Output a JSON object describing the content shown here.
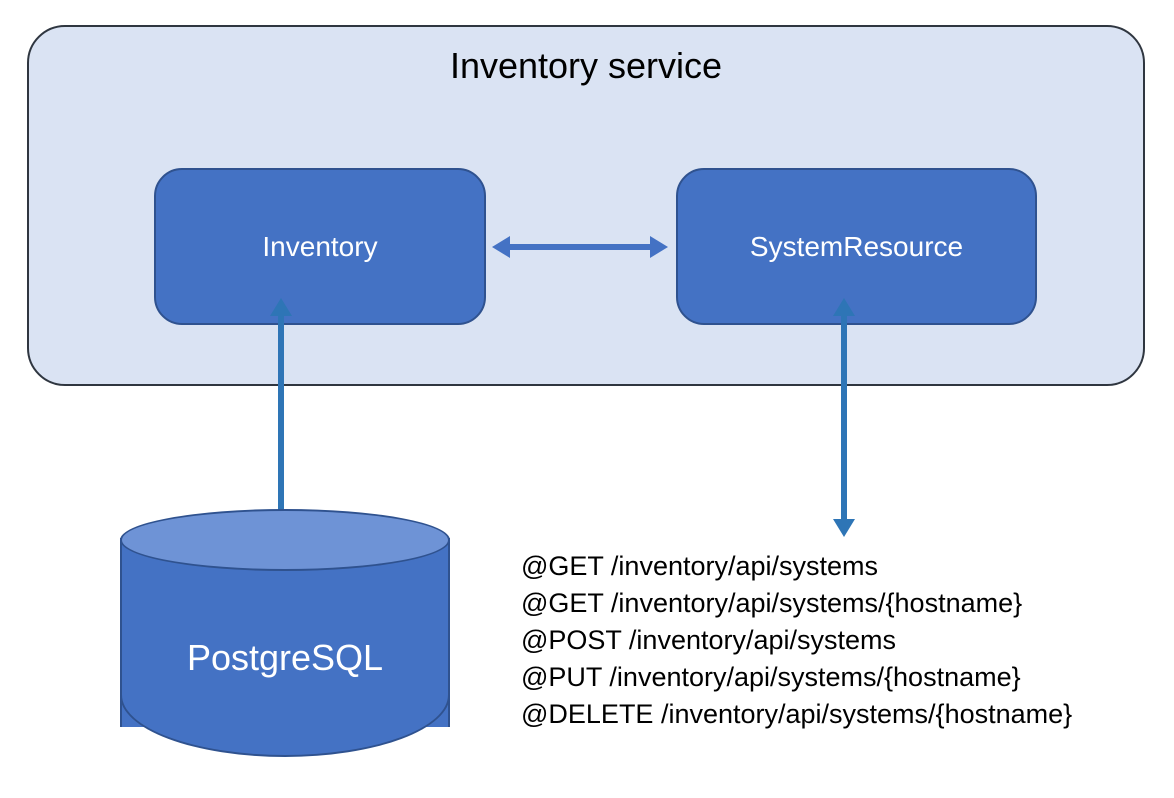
{
  "service": {
    "title": "Inventory service",
    "boxes": {
      "inventory": "Inventory",
      "systemresource": "SystemResource"
    }
  },
  "database": {
    "label": "PostgreSQL"
  },
  "api": {
    "endpoints": [
      "@GET /inventory/api/systems",
      "@GET /inventory/api/systems/{hostname}",
      "@POST /inventory/api/systems",
      "@PUT /inventory/api/systems/{hostname}",
      "@DELETE /inventory/api/systems/{hostname}"
    ]
  },
  "colors": {
    "container_fill": "#dae3f3",
    "box_fill": "#4472c4",
    "box_border": "#2f528f",
    "arrow": "#2e75b6"
  }
}
